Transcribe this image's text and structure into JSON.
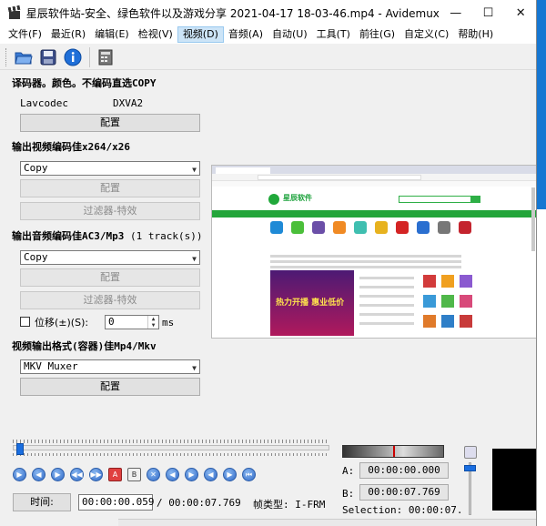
{
  "window": {
    "title": "星辰软件站-安全、绿色软件以及游戏分享 2021-04-17 18-03-46.mp4 - Avidemux",
    "minimize_glyph": "—",
    "maximize_glyph": "☐",
    "close_glyph": "✕"
  },
  "menu": [
    {
      "label": "文件(F)"
    },
    {
      "label": "最近(R)"
    },
    {
      "label": "编辑(E)"
    },
    {
      "label": "检视(V)"
    },
    {
      "label": "视频(D)",
      "active": true
    },
    {
      "label": "音频(A)"
    },
    {
      "label": "自动(U)"
    },
    {
      "label": "工具(T)"
    },
    {
      "label": "前往(G)"
    },
    {
      "label": "自定义(C)"
    },
    {
      "label": "帮助(H)"
    }
  ],
  "toolbar": {
    "icons": [
      "open-file-icon",
      "save-icon",
      "info-icon",
      "calculator-icon"
    ]
  },
  "decoder": {
    "heading": "译码器。颜色。不编码直选COPY",
    "codec_label": "Lavcodec",
    "accel_label": "DXVA2",
    "config_label": "配置"
  },
  "video_output": {
    "heading": "输出视频编码佳x264/x26",
    "selected": "Copy",
    "config_label": "配置",
    "filters_label": "过滤器-特效"
  },
  "audio_output": {
    "heading": "输出音频编码佳AC3/Mp3",
    "tracks": "(1 track(s))",
    "selected": "Copy",
    "config_label": "配置",
    "filters_label": "过滤器-特效",
    "shift_label": "位移(±)(S):",
    "shift_value": "0",
    "shift_unit": "ms"
  },
  "format": {
    "heading": "视频输出格式(容器)佳Mp4/Mkv",
    "selected": "MKV Muxer",
    "config_label": "配置"
  },
  "preview": {
    "site_name": "星辰软件",
    "banner_text": "热力开播 惠业低价",
    "colors": {
      "brand": "#1da23c",
      "banner_top": "#4c1a74",
      "banner_bottom": "#b0195c"
    }
  },
  "playback": {
    "position": 0.008,
    "time_label": "时间:",
    "current_time": "00:00:00.059",
    "total_time": "/ 00:00:07.769",
    "frame_type": "帧类型: I-FRM",
    "a_label": "A:",
    "a_value": "00:00:00.000",
    "b_label": "B:",
    "b_value": "00:00:07.769",
    "selection": "Selection: 00:00:07.",
    "volume": 0.95
  },
  "colors": {
    "accent": "#1a6ee0",
    "menu_active": "#cce4f7"
  }
}
